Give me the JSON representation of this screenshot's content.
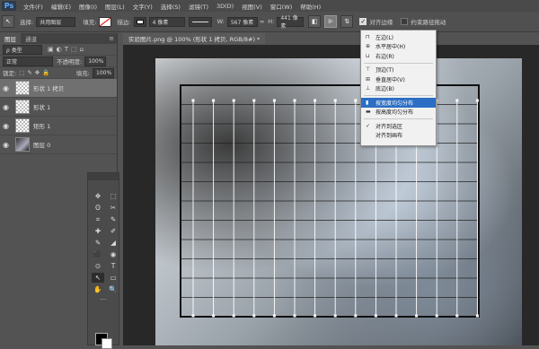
{
  "app": {
    "logo": "Ps"
  },
  "menubar": [
    "文件(F)",
    "编辑(E)",
    "图像(I)",
    "图层(L)",
    "文字(Y)",
    "选择(S)",
    "滤镜(T)",
    "3D(D)",
    "视图(V)",
    "窗口(W)",
    "帮助(H)"
  ],
  "options": {
    "path_label": "选择:",
    "path_value": "共用图层",
    "fill_label": "填充:",
    "stroke_label": "描边:",
    "stroke_width": "4 像素",
    "w_label": "W:",
    "w_value": "567 像素",
    "h_label": "H:",
    "h_value": "441 像素",
    "align_edges": "对齐边缘",
    "constrain_path": "约束路径拖动"
  },
  "layers_panel": {
    "tabs": [
      "图层",
      "通道"
    ],
    "kind_label": "ρ 类型",
    "blend_mode": "正常",
    "opacity_label": "不透明度:",
    "opacity_value": "100%",
    "lock_label": "锁定:",
    "fill_label": "填充:",
    "fill_value": "100%",
    "layers": [
      {
        "name": "形状 1 拷贝",
        "selected": true
      },
      {
        "name": "形状 1",
        "selected": false
      },
      {
        "name": "矩形 1",
        "selected": false
      },
      {
        "name": "图层 0",
        "selected": false
      }
    ]
  },
  "toolbox": {
    "tools": [
      "✥",
      "⬚",
      "ʘ",
      "✂",
      "⌗",
      "✎",
      "✚",
      "✐",
      "✎",
      "◢",
      "⬛",
      "◉",
      "⊙",
      "T",
      "↖",
      "▭",
      "✋",
      "🔍"
    ],
    "more": "···"
  },
  "document": {
    "tab_title": "实验图片.png @ 100% (形状 1 拷贝, RGB/8#) *"
  },
  "distribute_menu": {
    "items": [
      {
        "icon": "⊓",
        "label": "左边(L)"
      },
      {
        "icon": "⊕",
        "label": "水平居中(H)"
      },
      {
        "icon": "⊔",
        "label": "右边(R)"
      },
      {
        "icon": "⊤",
        "label": "顶边(T)"
      },
      {
        "icon": "⊞",
        "label": "垂直居中(V)"
      },
      {
        "icon": "⊥",
        "label": "底边(B)"
      },
      {
        "icon": "▮",
        "label": "按宽度均匀分布",
        "highlighted": true
      },
      {
        "icon": "▬",
        "label": "按高度均匀分布"
      },
      {
        "icon": "✓",
        "label": "对齐到选区"
      },
      {
        "icon": "",
        "label": "对齐到画布"
      }
    ]
  },
  "colors": {
    "highlight": "#2b6ec4",
    "ps_blue": "#5cb0ff"
  }
}
